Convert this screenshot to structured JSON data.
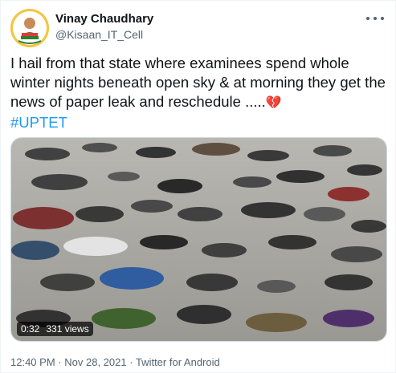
{
  "author": {
    "name": "Vinay Chaudhary",
    "handle": "@Kisaan_IT_Cell"
  },
  "tweet": {
    "text": "I hail from that state where examinees spend whole winter nights beneath open sky & at morning they get the news of paper leak and reschedule .....",
    "emoji": "💔",
    "hashtag": "#UPTET"
  },
  "video": {
    "duration": "0:32",
    "views": "331 views"
  },
  "footer": {
    "time": "12:40 PM",
    "separator1": "·",
    "date": "Nov 28, 2021",
    "separator2": "·",
    "source": "Twitter for Android"
  },
  "icons": [
    "avatar",
    "more-options-icon",
    "broken-heart-emoji"
  ]
}
